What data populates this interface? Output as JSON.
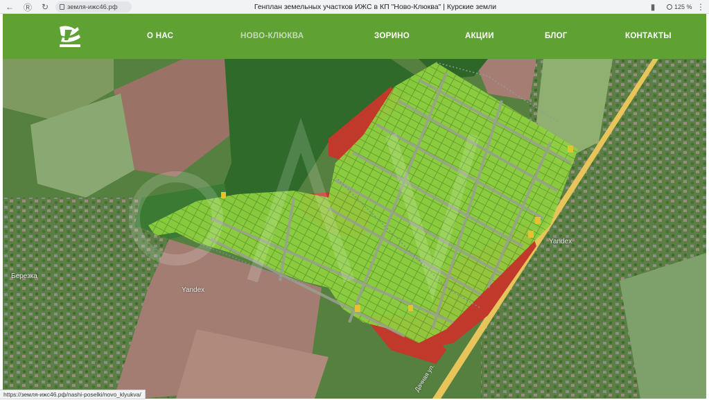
{
  "browser": {
    "url": "земля-ижс46.рф",
    "tab_title": "Генплан земельных участков ИЖС в КП \"Ново-Клюква\" | Курские земли",
    "zoom": "125 %",
    "status_url": "https://земля-ижс46.рф/nashi-poselki/novo_klyukva/"
  },
  "nav": {
    "items": [
      {
        "label": "О НАС"
      },
      {
        "label": "НОВО-КЛЮКВА"
      },
      {
        "label": "ЗОРИНО"
      },
      {
        "label": "АКЦИИ"
      },
      {
        "label": "БЛОГ"
      },
      {
        "label": "КОНТАКТЫ"
      }
    ],
    "active_index": 1
  },
  "map": {
    "labels": {
      "yandex_1": "Yandex",
      "yandex_2": "Yandex",
      "village": "Березка",
      "street": "Дачная ул."
    },
    "colors": {
      "available_plot": "#8fd13f",
      "sold_plot": "#c0392b",
      "reserved_plot": "#e8c22e",
      "road": "#e7c65a"
    }
  }
}
